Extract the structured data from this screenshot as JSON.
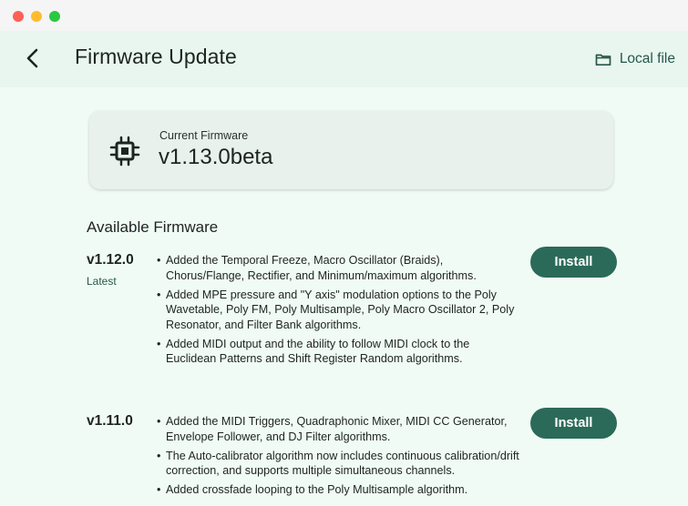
{
  "window": {
    "controls": [
      "close",
      "minimize",
      "zoom"
    ]
  },
  "appbar": {
    "title": "Firmware Update",
    "back_icon": "chevron-left-icon",
    "local_file_label": "Local file",
    "local_file_icon": "folder-icon"
  },
  "current": {
    "label": "Current Firmware",
    "version": "v1.13.0beta",
    "icon": "chip-icon"
  },
  "available": {
    "heading": "Available Firmware",
    "releases": [
      {
        "version": "v1.12.0",
        "tag": "Latest",
        "install_label": "Install",
        "notes": [
          "Added the Temporal Freeze, Macro Oscillator (Braids), Chorus/Flange, Rectifier, and Minimum/maximum algorithms.",
          "Added MPE pressure and \"Y axis\" modulation options to the Poly Wavetable, Poly FM, Poly Multisample, Poly Macro Oscillator 2, Poly Resonator, and Filter Bank algorithms.",
          "Added MIDI output and the ability to follow MIDI clock to the Euclidean Patterns and Shift Register Random algorithms."
        ]
      },
      {
        "version": "v1.11.0",
        "install_label": "Install",
        "notes": [
          "Added the MIDI Triggers, Quadraphonic Mixer, MIDI CC Generator, Envelope Follower, and DJ Filter algorithms.",
          "The Auto-calibrator algorithm now includes continuous calibration/drift correction, and supports multiple simultaneous channels.",
          "Added crossfade looping to the Poly Multisample algorithm."
        ]
      }
    ]
  },
  "colors": {
    "background": "#f1fbf6",
    "appbar": "#e8f6ef",
    "accent": "#2b6a58",
    "card": "#e9f1ed"
  }
}
